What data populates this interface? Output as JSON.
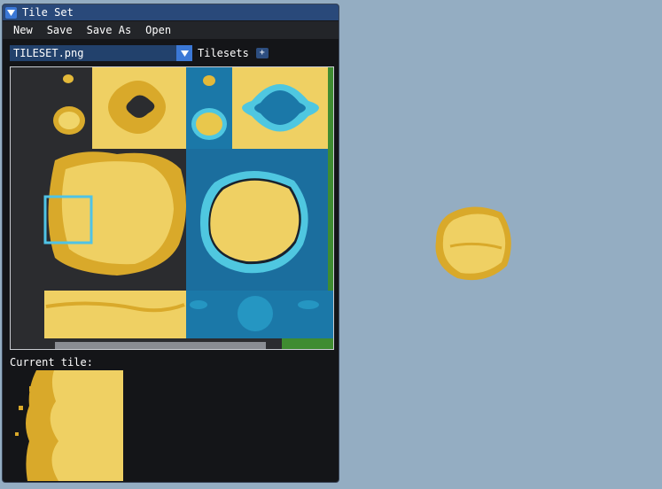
{
  "window": {
    "title": "Tile Set",
    "collapse_icon": "triangle-down-icon"
  },
  "menu": {
    "items": [
      "New",
      "Save",
      "Save As",
      "Open"
    ]
  },
  "toolbar": {
    "tileset_select_value": "TILESET.png",
    "tilesets_label": "Tilesets",
    "add_label": "+"
  },
  "current_tile": {
    "label": "Current tile:"
  },
  "colors": {
    "background": "#94adc2",
    "window_bg": "#141518",
    "title_bar": "#29497a",
    "accent": "#3b78d6",
    "sand": "#e9c74c",
    "water": "#1b78a8",
    "selection": "#4fc3e6"
  }
}
